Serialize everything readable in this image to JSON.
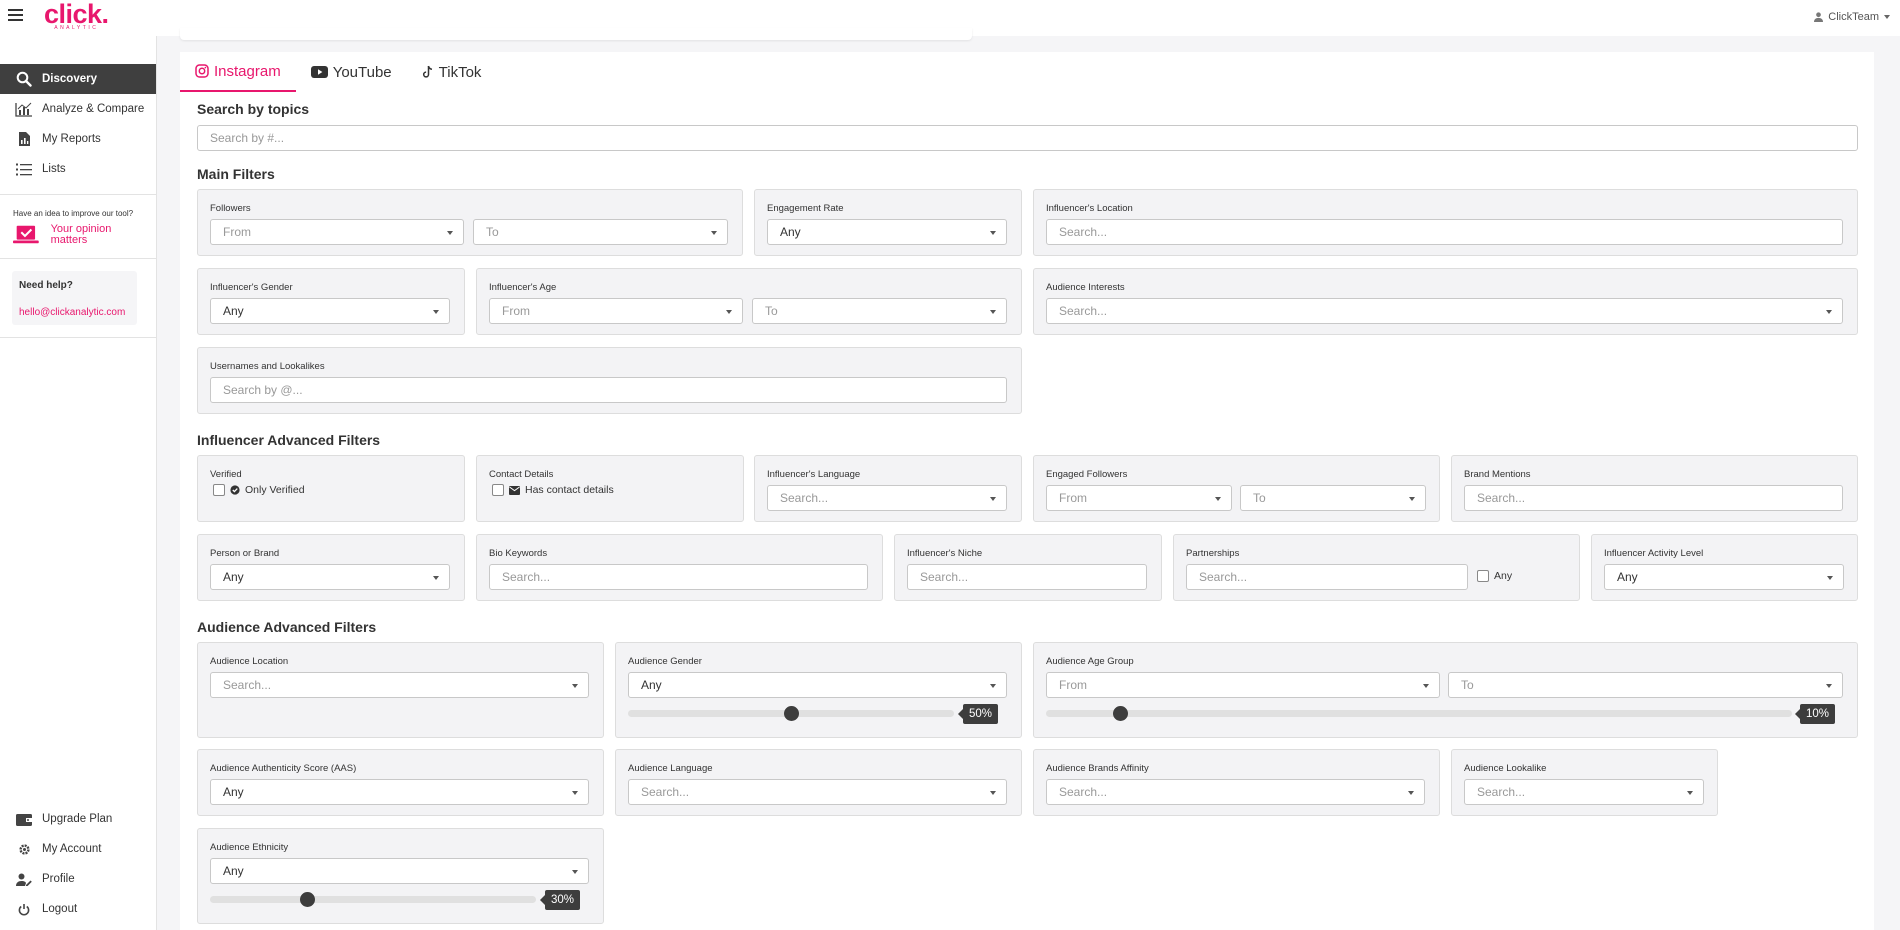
{
  "header": {
    "brand": "click.",
    "brand_sub": "ANALYTIC",
    "user": "ClickTeam"
  },
  "sidebar": {
    "items": [
      {
        "label": "Discovery",
        "icon": "search-icon"
      },
      {
        "label": "Analyze & Compare",
        "icon": "chart-icon"
      },
      {
        "label": "My Reports",
        "icon": "report-icon"
      },
      {
        "label": "Lists",
        "icon": "list-icon"
      }
    ],
    "idea_question": "Have an idea to improve our tool?",
    "idea_link": "Your opinion matters",
    "help_title": "Need help?",
    "help_email": "hello@clickanalytic.com",
    "bottom_items": [
      {
        "label": "Upgrade Plan",
        "icon": "wallet-icon"
      },
      {
        "label": "My Account",
        "icon": "gear-icon"
      },
      {
        "label": "Profile",
        "icon": "user-edit-icon"
      },
      {
        "label": "Logout",
        "icon": "power-icon"
      }
    ]
  },
  "tabs": [
    {
      "label": "Instagram",
      "icon": "instagram-icon",
      "active": true
    },
    {
      "label": "YouTube",
      "icon": "youtube-icon",
      "active": false
    },
    {
      "label": "TikTok",
      "icon": "tiktok-icon",
      "active": false
    }
  ],
  "topics": {
    "title": "Search by topics",
    "placeholder": "Search by #..."
  },
  "main_filters": {
    "title": "Main Filters",
    "followers": {
      "label": "Followers",
      "from": "From",
      "to": "To"
    },
    "engagement_rate": {
      "label": "Engagement Rate",
      "value": "Any"
    },
    "location": {
      "label": "Influencer's Location",
      "placeholder": "Search..."
    },
    "gender": {
      "label": "Influencer's Gender",
      "value": "Any"
    },
    "age": {
      "label": "Influencer's Age",
      "from": "From",
      "to": "To"
    },
    "interests": {
      "label": "Audience Interests",
      "placeholder": "Search..."
    },
    "usernames": {
      "label": "Usernames and Lookalikes",
      "placeholder": "Search by @..."
    }
  },
  "influencer_advanced": {
    "title": "Influencer Advanced Filters",
    "verified": {
      "label": "Verified",
      "option": "Only Verified"
    },
    "contact": {
      "label": "Contact Details",
      "option": "Has contact details"
    },
    "language": {
      "label": "Influencer's Language",
      "placeholder": "Search..."
    },
    "engaged_followers": {
      "label": "Engaged Followers",
      "from": "From",
      "to": "To"
    },
    "brand_mentions": {
      "label": "Brand Mentions",
      "placeholder": "Search..."
    },
    "person_brand": {
      "label": "Person or Brand",
      "value": "Any"
    },
    "bio_keywords": {
      "label": "Bio Keywords",
      "placeholder": "Search..."
    },
    "niche": {
      "label": "Influencer's Niche",
      "placeholder": "Search..."
    },
    "partnerships": {
      "label": "Partnerships",
      "placeholder": "Search...",
      "option": "Any"
    },
    "activity": {
      "label": "Influencer Activity Level",
      "value": "Any"
    }
  },
  "audience_advanced": {
    "title": "Audience Advanced Filters",
    "location": {
      "label": "Audience Location",
      "placeholder": "Search..."
    },
    "gender": {
      "label": "Audience Gender",
      "value": "Any",
      "percent": "50%",
      "slider": 0.5
    },
    "age_group": {
      "label": "Audience Age Group",
      "from": "From",
      "to": "To",
      "percent": "10%",
      "slider": 0.1
    },
    "aas": {
      "label": "Audience Authenticity Score (AAS)",
      "value": "Any"
    },
    "language": {
      "label": "Audience Language",
      "placeholder": "Search..."
    },
    "brands_affinity": {
      "label": "Audience Brands Affinity",
      "placeholder": "Search..."
    },
    "lookalike": {
      "label": "Audience Lookalike",
      "placeholder": "Search..."
    },
    "ethnicity": {
      "label": "Audience Ethnicity",
      "value": "Any",
      "percent": "30%",
      "slider": 0.3
    }
  }
}
